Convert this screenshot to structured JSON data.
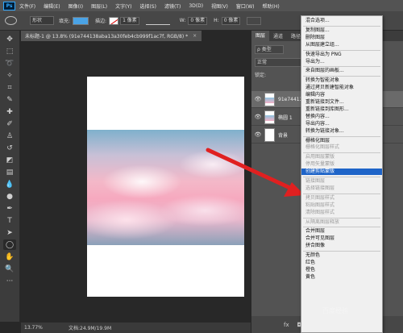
{
  "menubar": {
    "logo": "Ps",
    "items": [
      "文件(F)",
      "编辑(E)",
      "图像(I)",
      "图层(L)",
      "文字(Y)",
      "选择(S)",
      "滤镜(T)",
      "3D(D)",
      "视图(V)",
      "窗口(W)",
      "帮助(H)"
    ]
  },
  "options": {
    "mode": "形状",
    "fill_label": "填充:",
    "fill_color": "#4aa3e6",
    "stroke_label": "描边:",
    "stroke_width": "1 像素",
    "w_label": "W:",
    "w_value": "0 像素",
    "h_label": "H:",
    "h_value": "0 像素"
  },
  "document": {
    "tab_title": "未标题-1 @ 13.8% (91e744138aba13a30feb4cb999f1ac7f, RGB/8) *",
    "zoom": "13.77%",
    "doc_size": "文档:24.9M/19.9M"
  },
  "layers_panel": {
    "tabs": [
      "图层",
      "通道",
      "路径"
    ],
    "filter_kind": "ρ 类型",
    "blend_mode": "正常",
    "lock_label": "锁定:",
    "layers": [
      {
        "name": "91e744138",
        "selected": true,
        "type": "photo"
      },
      {
        "name": "椭圆 1",
        "selected": false,
        "type": "shape"
      },
      {
        "name": "背景",
        "selected": false,
        "type": "white"
      }
    ],
    "bottom_icons": [
      "fx",
      "◘",
      "●",
      "▭",
      "⌗",
      "🗑"
    ]
  },
  "context_menu": {
    "items": [
      {
        "label": "混合选项...",
        "state": "enabled"
      },
      {
        "sep": true
      },
      {
        "label": "复制图层...",
        "state": "enabled"
      },
      {
        "label": "删除图层",
        "state": "enabled"
      },
      {
        "label": "从图层建立组...",
        "state": "enabled"
      },
      {
        "sep": true
      },
      {
        "label": "快速导出为 PNG",
        "state": "enabled"
      },
      {
        "label": "导出为...",
        "state": "enabled"
      },
      {
        "sep": true
      },
      {
        "label": "来自图层的画板...",
        "state": "enabled"
      },
      {
        "sep": true
      },
      {
        "label": "转换为智能对象",
        "state": "enabled"
      },
      {
        "label": "通过拷贝新建智能对象",
        "state": "enabled"
      },
      {
        "label": "编辑内容",
        "state": "enabled"
      },
      {
        "label": "重新链接到文件...",
        "state": "enabled"
      },
      {
        "label": "重新链接到库图形...",
        "state": "enabled"
      },
      {
        "label": "替换内容...",
        "state": "enabled"
      },
      {
        "label": "导出内容...",
        "state": "enabled"
      },
      {
        "label": "转换为链接对象...",
        "state": "enabled"
      },
      {
        "sep": true
      },
      {
        "label": "栅格化图层",
        "state": "enabled"
      },
      {
        "label": "栅格化图层样式",
        "state": "disabled"
      },
      {
        "sep": true
      },
      {
        "label": "启用图层蒙版",
        "state": "disabled"
      },
      {
        "label": "停用矢量蒙版",
        "state": "disabled"
      },
      {
        "label": "创建剪贴蒙版",
        "state": "highlighted"
      },
      {
        "sep": true
      },
      {
        "label": "链接图层",
        "state": "disabled"
      },
      {
        "label": "选择链接图层",
        "state": "disabled"
      },
      {
        "sep": true
      },
      {
        "label": "拷贝图层样式",
        "state": "disabled"
      },
      {
        "label": "粘贴图层样式",
        "state": "disabled"
      },
      {
        "label": "清除图层样式",
        "state": "disabled"
      },
      {
        "sep": true
      },
      {
        "label": "从隔离图层释放",
        "state": "disabled"
      },
      {
        "sep": true
      },
      {
        "label": "合并图层",
        "state": "enabled"
      },
      {
        "label": "合并可见图层",
        "state": "enabled"
      },
      {
        "label": "拼合图像",
        "state": "enabled"
      },
      {
        "sep": true
      },
      {
        "label": "无颜色",
        "state": "enabled"
      },
      {
        "label": "红色",
        "state": "enabled"
      },
      {
        "label": "橙色",
        "state": "enabled"
      },
      {
        "label": "黄色",
        "state": "enabled"
      }
    ]
  },
  "colors": {
    "highlight": "#1e64c8",
    "arrow": "#e02020",
    "foreground": "#48a5e8",
    "background": "#ffffff"
  },
  "watermark": "百度经验"
}
